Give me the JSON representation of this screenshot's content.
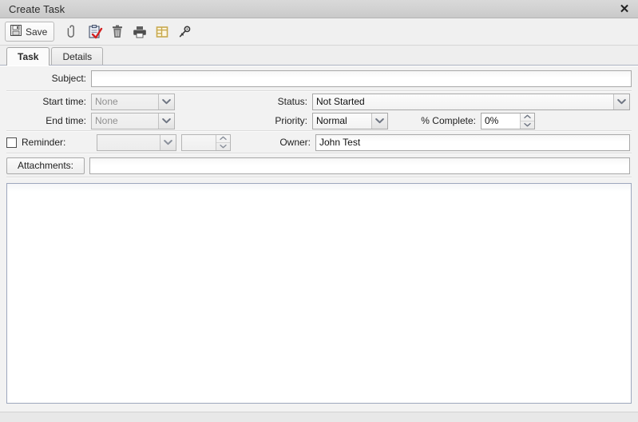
{
  "window": {
    "title": "Create Task",
    "close_label": "✕"
  },
  "toolbar": {
    "save_label": "Save",
    "icons": [
      {
        "name": "save-icon",
        "title": "Save"
      },
      {
        "name": "attachment-paperclip-icon",
        "title": "Attach"
      },
      {
        "name": "clipboard-check-icon",
        "title": "Task"
      },
      {
        "name": "trash-delete-icon",
        "title": "Delete"
      },
      {
        "name": "printer-icon",
        "title": "Print"
      },
      {
        "name": "table-layout-icon",
        "title": "Layout"
      },
      {
        "name": "key-icon",
        "title": "Permissions"
      }
    ]
  },
  "tabs": [
    {
      "label": "Task",
      "active": true
    },
    {
      "label": "Details",
      "active": false
    }
  ],
  "form": {
    "subject": {
      "label": "Subject:",
      "value": "",
      "placeholder": ""
    },
    "start_time": {
      "label": "Start time:",
      "value": "None",
      "disabled": true
    },
    "end_time": {
      "label": "End time:",
      "value": "None",
      "disabled": true
    },
    "status": {
      "label": "Status:",
      "value": "Not Started"
    },
    "priority": {
      "label": "Priority:",
      "value": "Normal"
    },
    "percent_complete": {
      "label": "% Complete:",
      "value": "0%"
    },
    "reminder": {
      "label": "Reminder:",
      "checked": false,
      "date_value": "",
      "time_value": ""
    },
    "owner": {
      "label": "Owner:",
      "value": "John Test"
    },
    "attachments": {
      "label": "Attachments:",
      "value": ""
    },
    "notes": {
      "value": ""
    }
  },
  "colors": {
    "titlebar": "#d2d2d2",
    "body": "#f2f2f2",
    "accent_gold": "#c8a94e",
    "note_border": "#9da7bd"
  }
}
